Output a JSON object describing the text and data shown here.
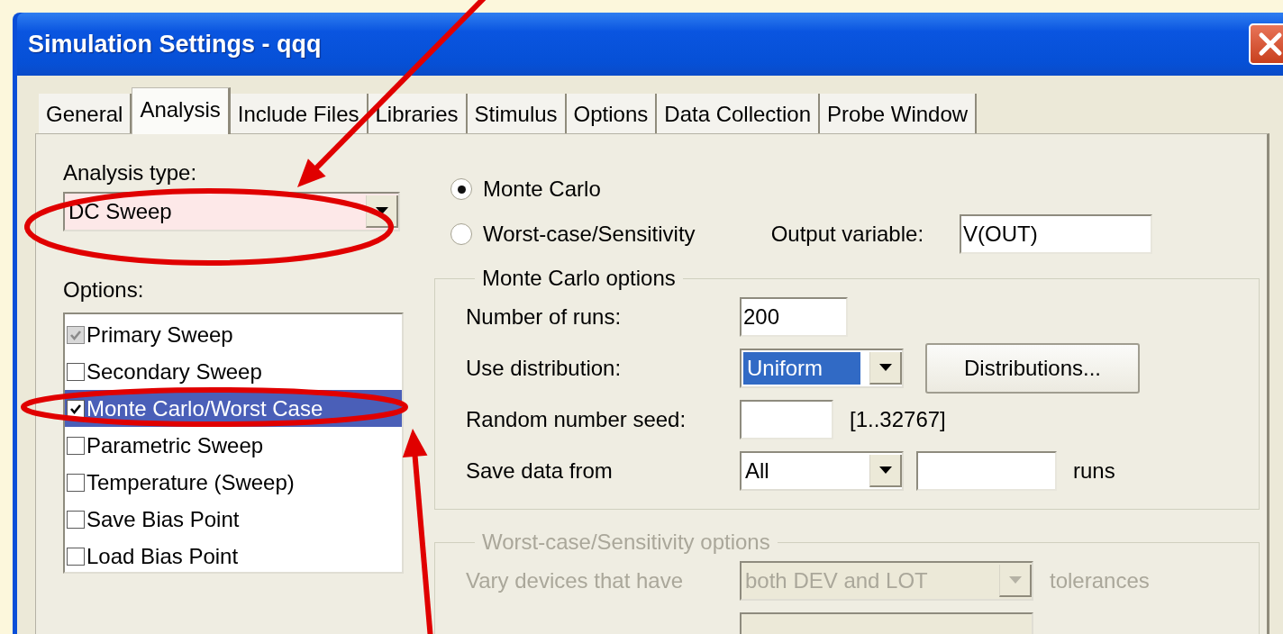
{
  "window": {
    "title": "Simulation Settings - qqq"
  },
  "tabs": [
    {
      "label": "General",
      "selected": false
    },
    {
      "label": "Analysis",
      "selected": true
    },
    {
      "label": "Include Files",
      "selected": false
    },
    {
      "label": "Libraries",
      "selected": false
    },
    {
      "label": "Stimulus",
      "selected": false
    },
    {
      "label": "Options",
      "selected": false
    },
    {
      "label": "Data Collection",
      "selected": false
    },
    {
      "label": "Probe Window",
      "selected": false
    }
  ],
  "analysis_type": {
    "label": "Analysis type:",
    "value": "DC Sweep"
  },
  "options": {
    "label": "Options:",
    "items": [
      {
        "label": "Primary Sweep",
        "checked": true,
        "disabled": true,
        "selected": false
      },
      {
        "label": "Secondary Sweep",
        "checked": false,
        "disabled": false,
        "selected": false
      },
      {
        "label": "Monte Carlo/Worst Case",
        "checked": true,
        "disabled": false,
        "selected": true
      },
      {
        "label": "Parametric Sweep",
        "checked": false,
        "disabled": false,
        "selected": false
      },
      {
        "label": "Temperature (Sweep)",
        "checked": false,
        "disabled": false,
        "selected": false
      },
      {
        "label": "Save Bias Point",
        "checked": false,
        "disabled": false,
        "selected": false
      },
      {
        "label": "Load Bias Point",
        "checked": false,
        "disabled": false,
        "selected": false
      }
    ]
  },
  "mode_radios": [
    {
      "label": "Monte Carlo",
      "selected": true
    },
    {
      "label": "Worst-case/Sensitivity",
      "selected": false
    }
  ],
  "output_variable": {
    "label": "Output variable:",
    "value": "V(OUT)"
  },
  "monte_carlo_options": {
    "title": "Monte Carlo options",
    "disabled": false,
    "number_of_runs": {
      "label": "Number of runs:",
      "value": "200"
    },
    "use_distribution": {
      "label": "Use distribution:",
      "value": "Uniform",
      "button": "Distributions..."
    },
    "random_seed": {
      "label": "Random number seed:",
      "range": "[1..32767]"
    },
    "save_data_from": {
      "label": "Save data from",
      "value": "All",
      "suffix": "runs"
    }
  },
  "worst_case_options": {
    "title": "Worst-case/Sensitivity options",
    "disabled": true,
    "vary_devices": {
      "label": "Vary devices that have",
      "value": "both DEV and LOT",
      "suffix": "tolerances"
    }
  },
  "annotations": [
    {
      "kind": "arrow"
    },
    {
      "kind": "ellipse"
    },
    {
      "kind": "ellipse"
    },
    {
      "kind": "arrow"
    }
  ]
}
